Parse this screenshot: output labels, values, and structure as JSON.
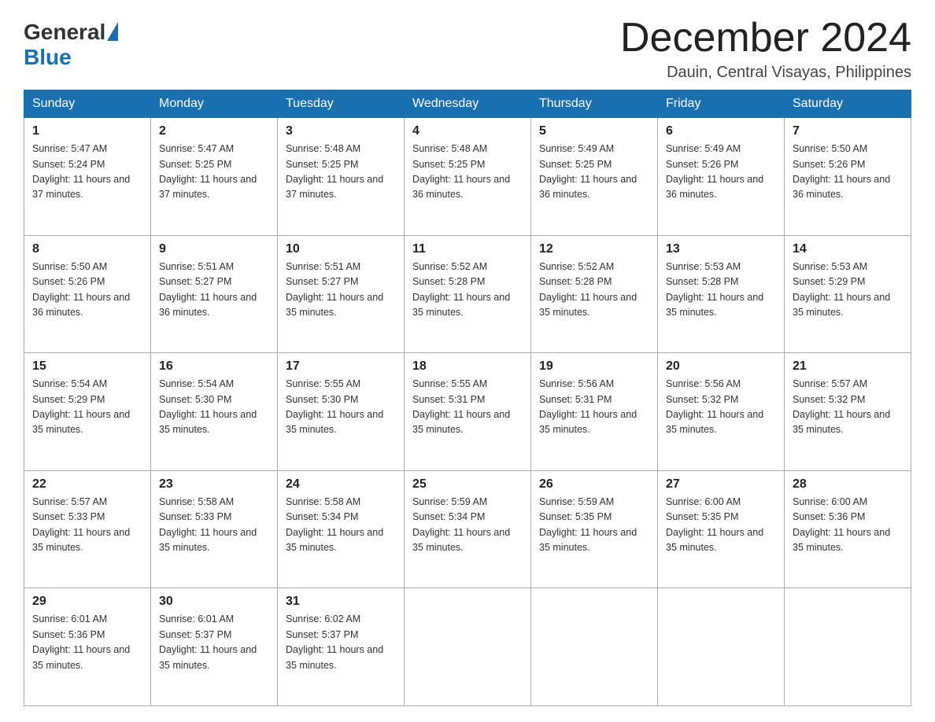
{
  "logo": {
    "general": "General",
    "blue": "Blue"
  },
  "header": {
    "month_year": "December 2024",
    "location": "Dauin, Central Visayas, Philippines"
  },
  "days_of_week": [
    "Sunday",
    "Monday",
    "Tuesday",
    "Wednesday",
    "Thursday",
    "Friday",
    "Saturday"
  ],
  "weeks": [
    [
      {
        "day": "1",
        "sunrise": "5:47 AM",
        "sunset": "5:24 PM",
        "daylight": "11 hours and 37 minutes."
      },
      {
        "day": "2",
        "sunrise": "5:47 AM",
        "sunset": "5:25 PM",
        "daylight": "11 hours and 37 minutes."
      },
      {
        "day": "3",
        "sunrise": "5:48 AM",
        "sunset": "5:25 PM",
        "daylight": "11 hours and 37 minutes."
      },
      {
        "day": "4",
        "sunrise": "5:48 AM",
        "sunset": "5:25 PM",
        "daylight": "11 hours and 36 minutes."
      },
      {
        "day": "5",
        "sunrise": "5:49 AM",
        "sunset": "5:25 PM",
        "daylight": "11 hours and 36 minutes."
      },
      {
        "day": "6",
        "sunrise": "5:49 AM",
        "sunset": "5:26 PM",
        "daylight": "11 hours and 36 minutes."
      },
      {
        "day": "7",
        "sunrise": "5:50 AM",
        "sunset": "5:26 PM",
        "daylight": "11 hours and 36 minutes."
      }
    ],
    [
      {
        "day": "8",
        "sunrise": "5:50 AM",
        "sunset": "5:26 PM",
        "daylight": "11 hours and 36 minutes."
      },
      {
        "day": "9",
        "sunrise": "5:51 AM",
        "sunset": "5:27 PM",
        "daylight": "11 hours and 36 minutes."
      },
      {
        "day": "10",
        "sunrise": "5:51 AM",
        "sunset": "5:27 PM",
        "daylight": "11 hours and 35 minutes."
      },
      {
        "day": "11",
        "sunrise": "5:52 AM",
        "sunset": "5:28 PM",
        "daylight": "11 hours and 35 minutes."
      },
      {
        "day": "12",
        "sunrise": "5:52 AM",
        "sunset": "5:28 PM",
        "daylight": "11 hours and 35 minutes."
      },
      {
        "day": "13",
        "sunrise": "5:53 AM",
        "sunset": "5:28 PM",
        "daylight": "11 hours and 35 minutes."
      },
      {
        "day": "14",
        "sunrise": "5:53 AM",
        "sunset": "5:29 PM",
        "daylight": "11 hours and 35 minutes."
      }
    ],
    [
      {
        "day": "15",
        "sunrise": "5:54 AM",
        "sunset": "5:29 PM",
        "daylight": "11 hours and 35 minutes."
      },
      {
        "day": "16",
        "sunrise": "5:54 AM",
        "sunset": "5:30 PM",
        "daylight": "11 hours and 35 minutes."
      },
      {
        "day": "17",
        "sunrise": "5:55 AM",
        "sunset": "5:30 PM",
        "daylight": "11 hours and 35 minutes."
      },
      {
        "day": "18",
        "sunrise": "5:55 AM",
        "sunset": "5:31 PM",
        "daylight": "11 hours and 35 minutes."
      },
      {
        "day": "19",
        "sunrise": "5:56 AM",
        "sunset": "5:31 PM",
        "daylight": "11 hours and 35 minutes."
      },
      {
        "day": "20",
        "sunrise": "5:56 AM",
        "sunset": "5:32 PM",
        "daylight": "11 hours and 35 minutes."
      },
      {
        "day": "21",
        "sunrise": "5:57 AM",
        "sunset": "5:32 PM",
        "daylight": "11 hours and 35 minutes."
      }
    ],
    [
      {
        "day": "22",
        "sunrise": "5:57 AM",
        "sunset": "5:33 PM",
        "daylight": "11 hours and 35 minutes."
      },
      {
        "day": "23",
        "sunrise": "5:58 AM",
        "sunset": "5:33 PM",
        "daylight": "11 hours and 35 minutes."
      },
      {
        "day": "24",
        "sunrise": "5:58 AM",
        "sunset": "5:34 PM",
        "daylight": "11 hours and 35 minutes."
      },
      {
        "day": "25",
        "sunrise": "5:59 AM",
        "sunset": "5:34 PM",
        "daylight": "11 hours and 35 minutes."
      },
      {
        "day": "26",
        "sunrise": "5:59 AM",
        "sunset": "5:35 PM",
        "daylight": "11 hours and 35 minutes."
      },
      {
        "day": "27",
        "sunrise": "6:00 AM",
        "sunset": "5:35 PM",
        "daylight": "11 hours and 35 minutes."
      },
      {
        "day": "28",
        "sunrise": "6:00 AM",
        "sunset": "5:36 PM",
        "daylight": "11 hours and 35 minutes."
      }
    ],
    [
      {
        "day": "29",
        "sunrise": "6:01 AM",
        "sunset": "5:36 PM",
        "daylight": "11 hours and 35 minutes."
      },
      {
        "day": "30",
        "sunrise": "6:01 AM",
        "sunset": "5:37 PM",
        "daylight": "11 hours and 35 minutes."
      },
      {
        "day": "31",
        "sunrise": "6:02 AM",
        "sunset": "5:37 PM",
        "daylight": "11 hours and 35 minutes."
      },
      null,
      null,
      null,
      null
    ]
  ]
}
